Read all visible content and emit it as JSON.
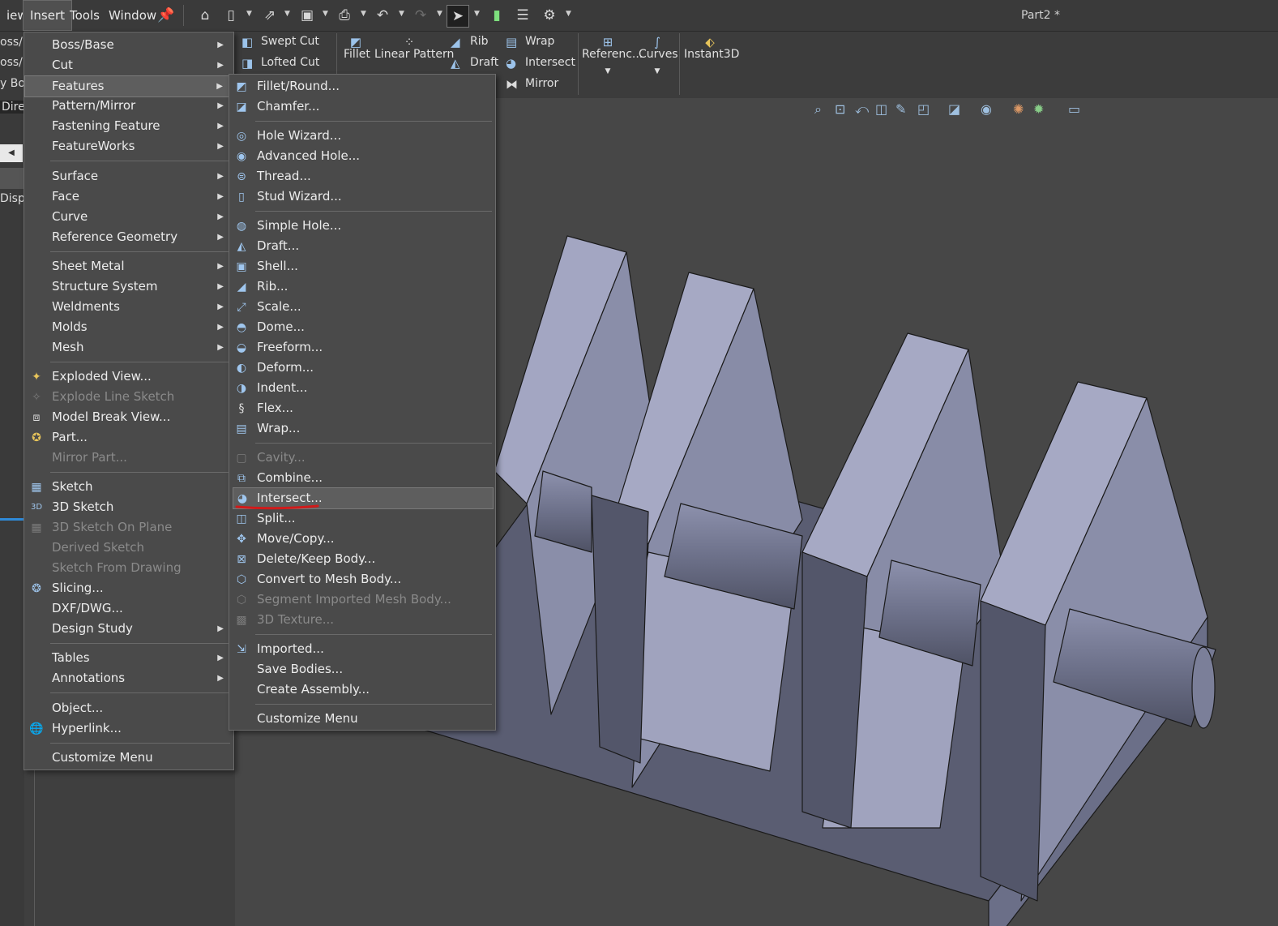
{
  "window": {
    "title": "Part2 *"
  },
  "menubar": {
    "items": [
      {
        "label": "iew"
      },
      {
        "label": "Insert"
      },
      {
        "label": "Tools"
      },
      {
        "label": "Window"
      }
    ]
  },
  "commandmanager": {
    "buttons": {
      "swept_cut": "Swept Cut",
      "lofted_cut": "Lofted Cut",
      "fillet": "Fillet",
      "linear_pattern": "Linear Pattern",
      "rib": "Rib",
      "draft": "Draft",
      "wrap": "Wrap",
      "intersect": "Intersect",
      "mirror": "Mirror",
      "reference": "Referenc...",
      "curves": "Curves",
      "instant3d": "Instant3D"
    }
  },
  "leftpanel": {
    "fragments": [
      "oss/B",
      "oss/B",
      "y Bos",
      "Direct",
      "Displa"
    ]
  },
  "insert_menu": {
    "items": [
      {
        "label": "Boss/Base",
        "submenu": true
      },
      {
        "label": "Cut",
        "submenu": true
      },
      {
        "label": "Features",
        "submenu": true,
        "highlighted": true
      },
      {
        "label": "Pattern/Mirror",
        "submenu": true
      },
      {
        "label": "Fastening Feature",
        "submenu": true
      },
      {
        "label": "FeatureWorks",
        "submenu": true
      },
      {
        "label": "Surface",
        "submenu": true
      },
      {
        "label": "Face",
        "submenu": true
      },
      {
        "label": "Curve",
        "submenu": true
      },
      {
        "label": "Reference Geometry",
        "submenu": true
      },
      {
        "label": "Sheet Metal",
        "submenu": true
      },
      {
        "label": "Structure System",
        "submenu": true
      },
      {
        "label": "Weldments",
        "submenu": true
      },
      {
        "label": "Molds",
        "submenu": true
      },
      {
        "label": "Mesh",
        "submenu": true
      },
      {
        "label": "Exploded View..."
      },
      {
        "label": "Explode Line Sketch",
        "disabled": true
      },
      {
        "label": "Model Break View..."
      },
      {
        "label": "Part..."
      },
      {
        "label": "Mirror Part...",
        "disabled": true
      },
      {
        "label": "Sketch"
      },
      {
        "label": "3D Sketch"
      },
      {
        "label": "3D Sketch On Plane",
        "disabled": true
      },
      {
        "label": "Derived Sketch",
        "disabled": true
      },
      {
        "label": "Sketch From Drawing",
        "disabled": true
      },
      {
        "label": "Slicing..."
      },
      {
        "label": "DXF/DWG..."
      },
      {
        "label": "Design Study",
        "submenu": true
      },
      {
        "label": "Tables",
        "submenu": true
      },
      {
        "label": "Annotations",
        "submenu": true
      },
      {
        "label": "Object..."
      },
      {
        "label": "Hyperlink..."
      },
      {
        "label": "Customize Menu"
      }
    ]
  },
  "features_menu": {
    "items": [
      {
        "label": "Fillet/Round..."
      },
      {
        "label": "Chamfer..."
      },
      {
        "label": "Hole Wizard..."
      },
      {
        "label": "Advanced Hole..."
      },
      {
        "label": "Thread..."
      },
      {
        "label": "Stud Wizard..."
      },
      {
        "label": "Simple Hole..."
      },
      {
        "label": "Draft..."
      },
      {
        "label": "Shell..."
      },
      {
        "label": "Rib..."
      },
      {
        "label": "Scale..."
      },
      {
        "label": "Dome..."
      },
      {
        "label": "Freeform..."
      },
      {
        "label": "Deform..."
      },
      {
        "label": "Indent..."
      },
      {
        "label": "Flex..."
      },
      {
        "label": "Wrap..."
      },
      {
        "label": "Cavity...",
        "disabled": true
      },
      {
        "label": "Combine..."
      },
      {
        "label": "Intersect...",
        "highlighted": true
      },
      {
        "label": "Split..."
      },
      {
        "label": "Move/Copy..."
      },
      {
        "label": "Delete/Keep Body..."
      },
      {
        "label": "Convert to Mesh Body..."
      },
      {
        "label": "Segment Imported Mesh Body...",
        "disabled": true
      },
      {
        "label": "3D Texture...",
        "disabled": true
      },
      {
        "label": "Imported..."
      },
      {
        "label": "Save Bodies..."
      },
      {
        "label": "Create Assembly..."
      },
      {
        "label": "Customize Menu"
      }
    ]
  },
  "colors": {
    "menu_bg": "#4a4a4a",
    "highlight": "#5e5e5e",
    "annotation_red": "#d11a1a",
    "model_light": "#a6a9c4",
    "model_mid": "#858aa6",
    "model_dark": "#595d73"
  }
}
